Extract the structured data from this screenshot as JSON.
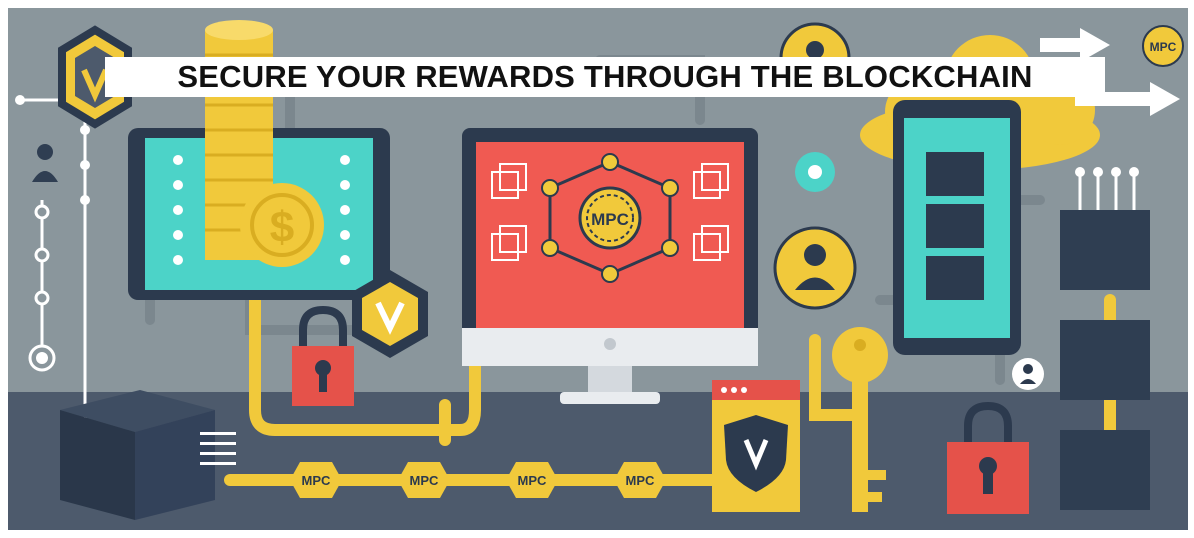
{
  "banner": {
    "title": "SECURE YOUR REWARDS THROUGH THE BLOCKCHAIN",
    "token_label": "MPC",
    "dollar_symbol": "$",
    "check_symbol": "V"
  },
  "colors": {
    "background": "#8a969c",
    "floor": "#4d5a6c",
    "pipe": "#f1c93b",
    "screen_teal": "#4cd3c8",
    "screen_red": "#f05a52",
    "dark_block": "#2f3e52",
    "lock_red": "#e5524a",
    "device_frame": "#2c3a4e"
  },
  "icons": [
    "shield-check-icon",
    "coin-stack-icon",
    "dollar-coin-icon",
    "padlock-icon",
    "key-icon",
    "gear-icon",
    "user-icon",
    "blockchain-cube-icon",
    "cloud-icon",
    "arrow-right-icon",
    "mpc-token-icon"
  ]
}
